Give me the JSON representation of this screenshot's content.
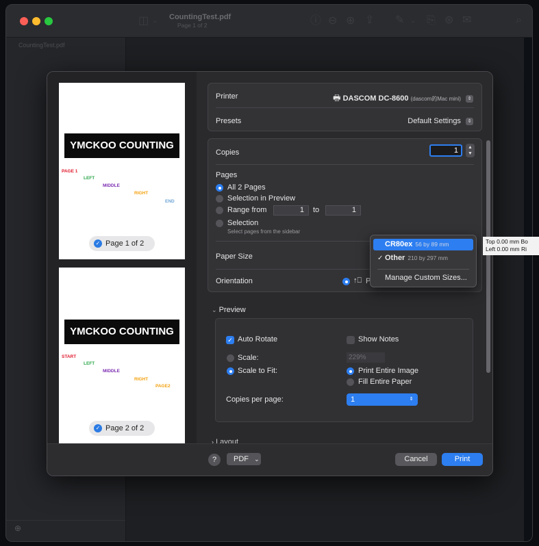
{
  "app": {
    "title": "CountingTest.pdf",
    "subtitle": "Page 1 of 2",
    "sidebar_file": "CountingTest.pdf"
  },
  "dialog": {
    "thumbnails": [
      {
        "banner": "YMCKOO COUNTING",
        "words": [
          "PAGE 1",
          "LEFT",
          "MIDDLE",
          "RIGHT",
          "END"
        ],
        "pill": "Page 1 of 2"
      },
      {
        "banner": "YMCKOO COUNTING",
        "words": [
          "START",
          "LEFT",
          "MIDDLE",
          "RIGHT",
          "PAGE2"
        ],
        "pill": "Page 2 of 2"
      }
    ],
    "printer": {
      "label": "Printer",
      "value": "DASCOM DC-8600",
      "value_suffix": "(dascom的Mac mini)"
    },
    "presets": {
      "label": "Presets",
      "value": "Default Settings"
    },
    "copies": {
      "label": "Copies",
      "value": "1"
    },
    "pages": {
      "label": "Pages",
      "all": "All 2 Pages",
      "selection_preview": "Selection in Preview",
      "range_from": "Range from",
      "range_to_label": "to",
      "range_from_value": "1",
      "range_to_value": "1",
      "selection": "Selection",
      "selection_hint": "Select pages from the sidebar"
    },
    "paper_size": {
      "label": "Paper Size"
    },
    "orientation": {
      "label": "Orientation",
      "value": "P"
    },
    "paper_menu": {
      "items": [
        {
          "name": "CR80ex",
          "detail": "56 by 89 mm",
          "selected": true,
          "checked": false
        },
        {
          "name": "Other",
          "detail": "210 by 297 mm",
          "selected": false,
          "checked": true
        }
      ],
      "manage": "Manage Custom Sizes..."
    },
    "margins_tooltip": {
      "line1": "Top 0.00 mm  Bo",
      "line2": "Left 0.00 mm  Ri"
    },
    "preview": {
      "section_label": "Preview",
      "auto_rotate": "Auto Rotate",
      "show_notes": "Show Notes",
      "scale_label": "Scale:",
      "scale_value": "229%",
      "scale_to_fit": "Scale to Fit:",
      "print_entire_image": "Print Entire Image",
      "fill_entire_paper": "Fill Entire Paper",
      "copies_per_page_label": "Copies per page:",
      "copies_per_page_value": "1"
    },
    "layout_label": "Layout",
    "footer": {
      "help": "?",
      "pdf": "PDF",
      "cancel": "Cancel",
      "print": "Print"
    }
  },
  "colors": {
    "accent": "#2d7ef0",
    "close": "#ff5f57",
    "minimize": "#febc2e",
    "zoom": "#28c840"
  }
}
